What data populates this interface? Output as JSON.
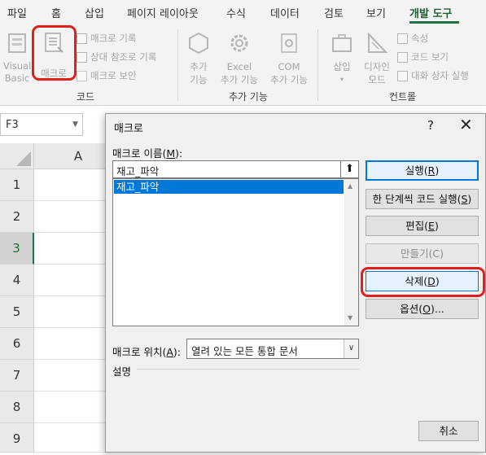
{
  "ribbon_tabs": [
    {
      "label": "파일"
    },
    {
      "label": "홈"
    },
    {
      "label": "삽입"
    },
    {
      "label": "페이지 레이아웃"
    },
    {
      "label": "수식"
    },
    {
      "label": "데이터"
    },
    {
      "label": "검토"
    },
    {
      "label": "보기"
    },
    {
      "label": "개발 도구",
      "active": true
    }
  ],
  "ribbon": {
    "code_group": {
      "label": "코드",
      "visual_basic": "Visual Basic",
      "macro": "매크로",
      "record_macro": "매크로 기록",
      "relative_ref": "상대 참조로 기록",
      "macro_security": "매크로 보안"
    },
    "addins_group": {
      "label": "추가 기능",
      "addins_line1": "추가",
      "addins_line2": "기능",
      "excel_addins_line1": "Excel",
      "excel_addins_line2": "추가 기능",
      "com_addins_line1": "COM",
      "com_addins_line2": "추가 기능"
    },
    "controls_group": {
      "label": "컨트롤",
      "insert": "삽입",
      "design_mode_line1": "디자인",
      "design_mode_line2": "모드",
      "properties": "속성",
      "view_code": "코드 보기",
      "run_dialog": "대화 상자 실행"
    }
  },
  "name_box": {
    "value": "F3"
  },
  "sheet": {
    "column_header": "A",
    "rows": [
      "1",
      "2",
      "3",
      "4",
      "5",
      "6",
      "7",
      "8",
      "9"
    ],
    "selected_row": "3"
  },
  "dialog": {
    "title": "매크로",
    "help": "?",
    "close": "✕",
    "name_label": "매크로 이름(",
    "name_key": "M",
    "name_label_end": "):",
    "name_value": "재고_파악",
    "list_items": [
      "재고_파악"
    ],
    "location_label": "매크로 위치(",
    "location_key": "A",
    "location_label_end": "):",
    "location_value": "열려 있는 모든 통합 문서",
    "description_label": "설명",
    "buttons": {
      "run": {
        "pre": "실행(",
        "key": "R",
        "post": ")"
      },
      "step_into": {
        "pre": "한 단계씩 코드 실행(",
        "key": "S",
        "post": ")"
      },
      "edit": {
        "pre": "편집(",
        "key": "E",
        "post": ")"
      },
      "create": {
        "pre": "만들기(",
        "key": "C",
        "post": ")"
      },
      "delete": {
        "pre": "삭제(",
        "key": "D",
        "post": ")"
      },
      "options": {
        "pre": "옵션(",
        "key": "O",
        "post": ")..."
      },
      "cancel": "취소"
    }
  },
  "colors": {
    "accent": "#217346",
    "highlight_ring": "#e0201a",
    "selection": "#0078d7"
  }
}
